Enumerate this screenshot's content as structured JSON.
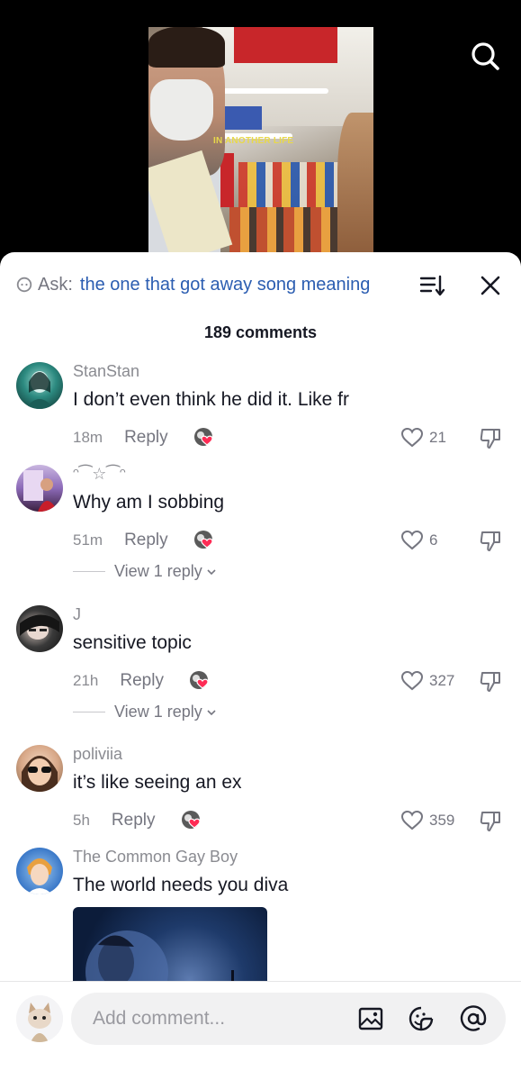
{
  "video": {
    "caption": "IN ANOTHER LIFE"
  },
  "ask": {
    "label": "Ask:",
    "query": "the one that got away song meaning"
  },
  "comments_count": "189 comments",
  "comments": [
    {
      "name": "StanStan",
      "text": "I don’t even think he did it. Like fr",
      "time": "18m",
      "reply": "Reply",
      "likes": "21"
    },
    {
      "name": "ᵔ⁀☆⁀ᵔ",
      "text": "Why am I sobbing",
      "time": "51m",
      "reply": "Reply",
      "likes": "6",
      "view_replies": "View 1 reply"
    },
    {
      "name": "J",
      "text": "sensitive topic",
      "time": "21h",
      "reply": "Reply",
      "likes": "327",
      "view_replies": "View 1 reply"
    },
    {
      "name": "poliviia",
      "text": "it’s like seeing an ex",
      "time": "5h",
      "reply": "Reply",
      "likes": "359"
    },
    {
      "name": "The Common Gay Boy",
      "text": "The world needs you diva"
    }
  ],
  "composer": {
    "placeholder": "Add comment..."
  },
  "colors": {
    "accent_link": "#2b5db1",
    "heart_red": "#fe2c55",
    "text_primary": "#161823",
    "text_secondary": "#8a8b91"
  }
}
